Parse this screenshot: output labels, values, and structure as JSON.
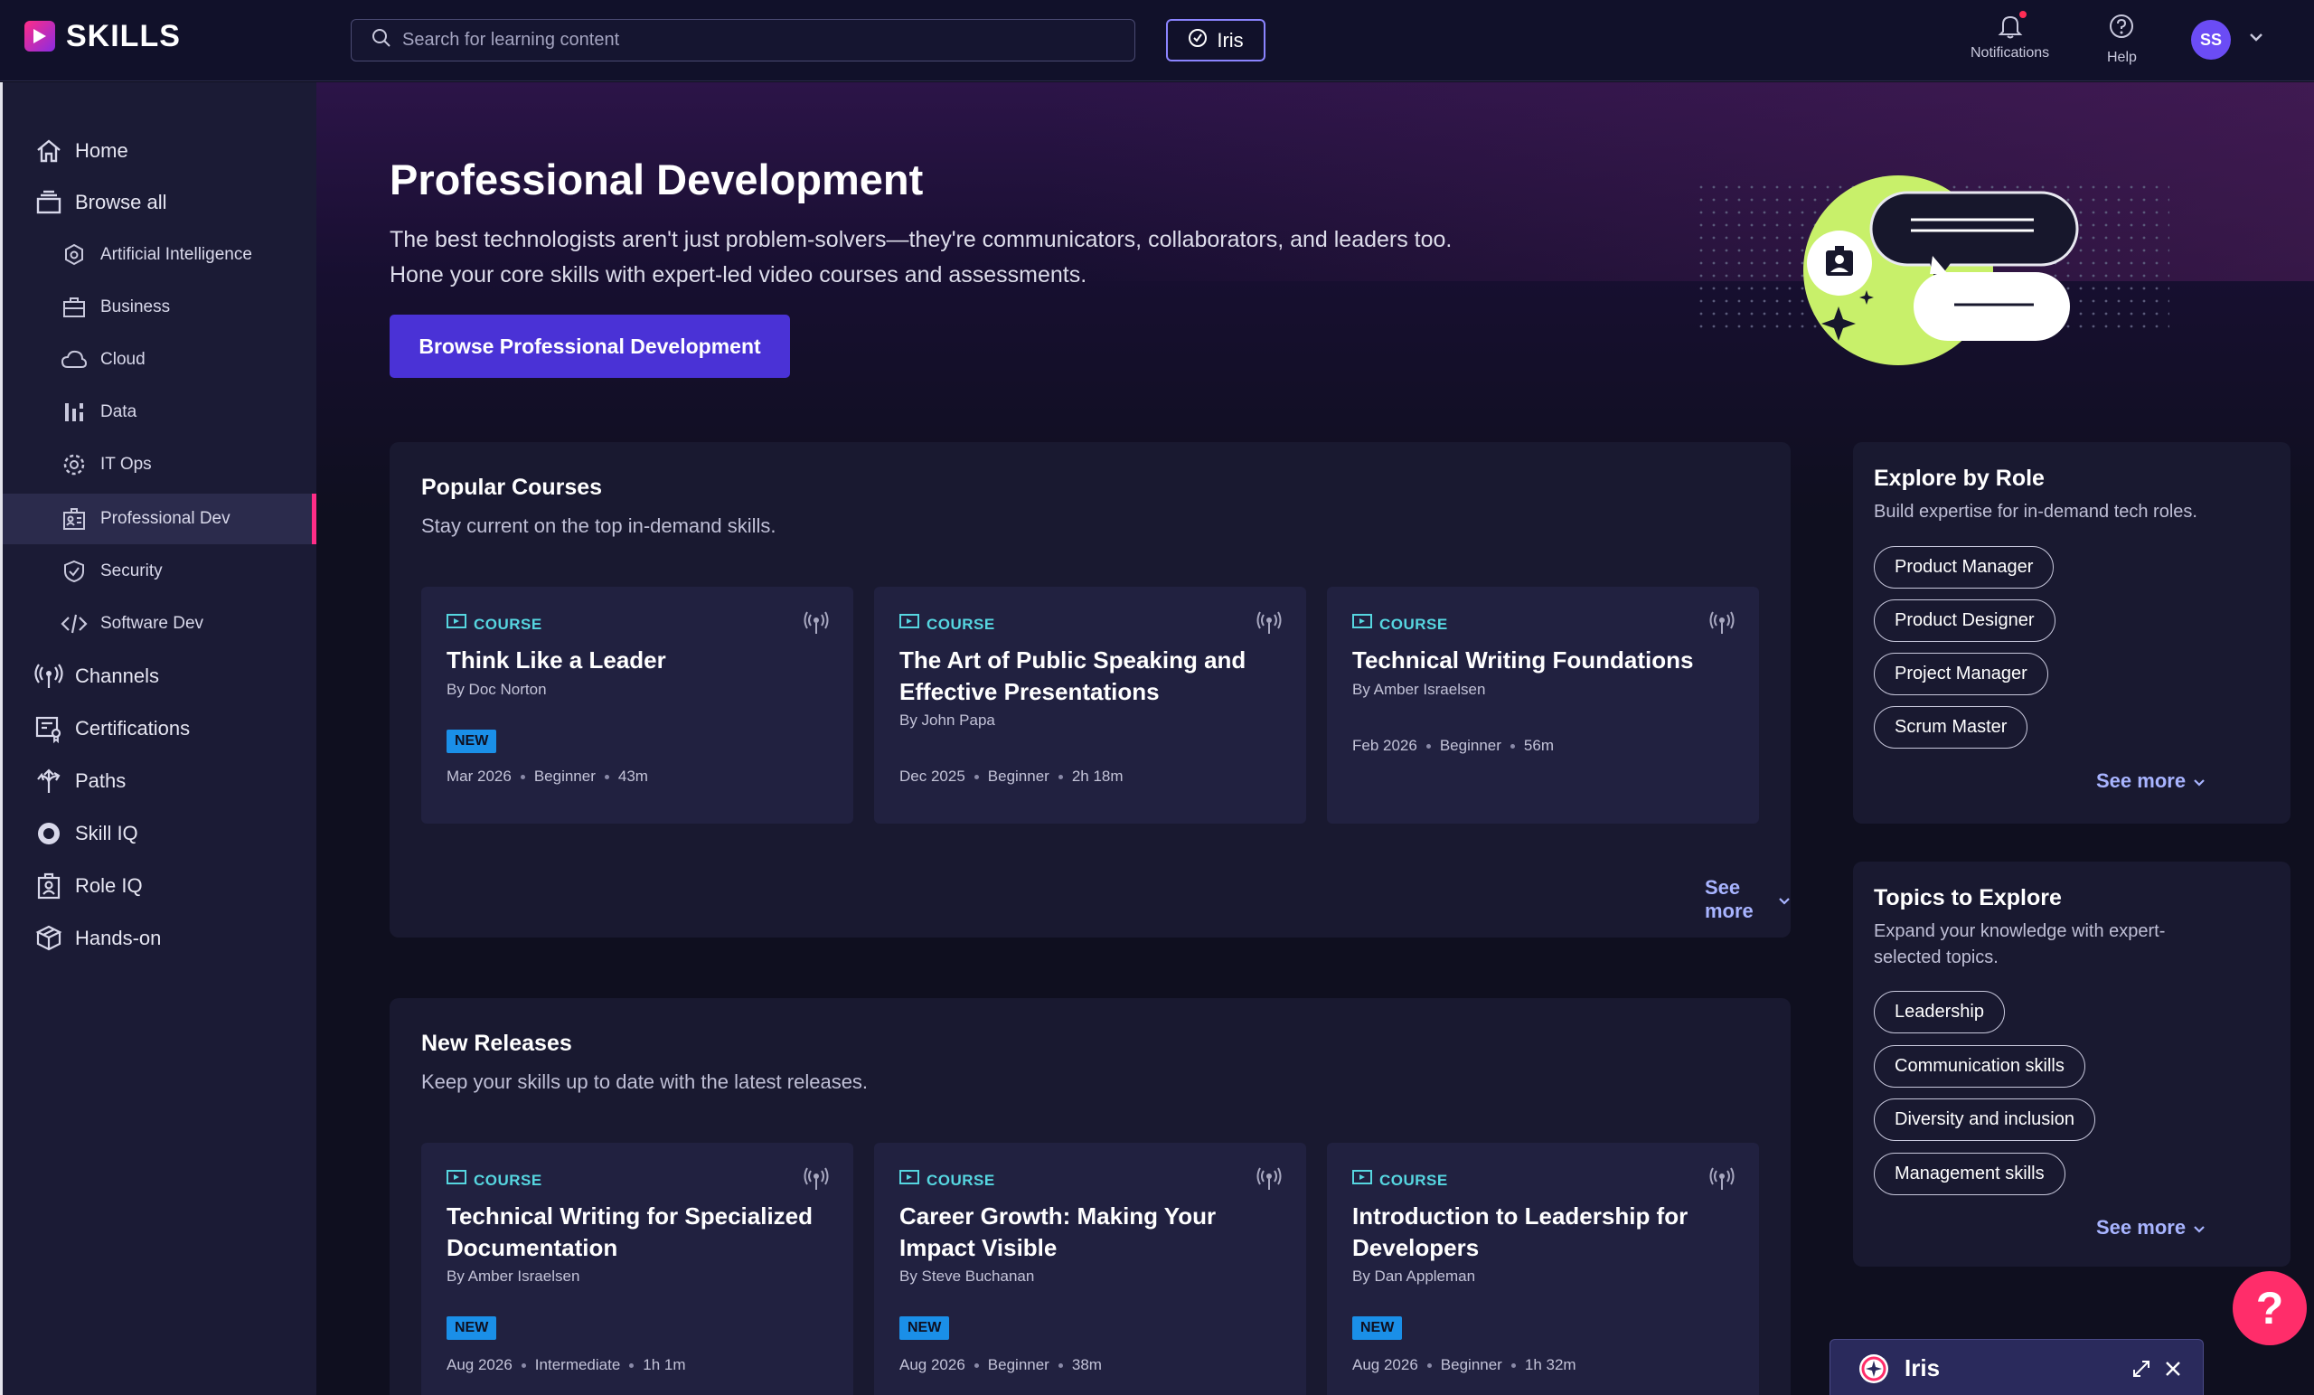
{
  "brand": {
    "name": "SKILLS"
  },
  "topbar": {
    "search_placeholder": "Search for learning content",
    "iris_label": "Iris",
    "notifications_label": "Notifications",
    "help_label": "Help",
    "avatar_initials": "SS"
  },
  "sidebar": {
    "items": [
      {
        "label": "Home",
        "icon": "home-icon"
      },
      {
        "label": "Browse all",
        "icon": "browse-icon"
      },
      {
        "label": "Artificial Intelligence",
        "icon": "ai-icon"
      },
      {
        "label": "Business",
        "icon": "briefcase-icon"
      },
      {
        "label": "Cloud",
        "icon": "cloud-icon"
      },
      {
        "label": "Data",
        "icon": "data-icon"
      },
      {
        "label": "IT Ops",
        "icon": "gear-icon"
      },
      {
        "label": "Professional Dev",
        "icon": "id-card-icon",
        "active": true
      },
      {
        "label": "Security",
        "icon": "shield-icon"
      },
      {
        "label": "Software Dev",
        "icon": "code-icon"
      },
      {
        "label": "Channels",
        "icon": "broadcast-icon"
      },
      {
        "label": "Certifications",
        "icon": "certificate-icon"
      },
      {
        "label": "Paths",
        "icon": "paths-icon"
      },
      {
        "label": "Skill IQ",
        "icon": "skill-iq-icon"
      },
      {
        "label": "Role IQ",
        "icon": "role-iq-icon"
      },
      {
        "label": "Hands-on",
        "icon": "hands-on-icon"
      }
    ]
  },
  "hero": {
    "title": "Professional Development",
    "description": "The best technologists aren't just problem-solvers—they're communicators, collaborators, and leaders too. Hone your core skills with expert-led video courses and assessments.",
    "button_label": "Browse Professional Development"
  },
  "popular": {
    "title": "Popular Courses",
    "subtitle": "Stay current on the top in-demand skills.",
    "see_more": "See more",
    "cards": [
      {
        "tag": "COURSE",
        "title": "Think Like a Leader",
        "author": "By Doc Norton",
        "badge": "NEW",
        "date": "Mar 2026",
        "level": "Beginner",
        "duration": "43m"
      },
      {
        "tag": "COURSE",
        "title": "The Art of Public Speaking and Effective Presentations",
        "author": "By John Papa",
        "date": "Dec 2025",
        "level": "Beginner",
        "duration": "2h 18m"
      },
      {
        "tag": "COURSE",
        "title": "Technical Writing Foundations",
        "author": "By Amber Israelsen",
        "date": "Feb 2026",
        "level": "Beginner",
        "duration": "56m"
      }
    ]
  },
  "new_releases": {
    "title": "New Releases",
    "subtitle": "Keep your skills up to date with the latest releases.",
    "cards": [
      {
        "tag": "COURSE",
        "title": "Technical Writing for Specialized Documentation",
        "author": "By Amber Israelsen",
        "badge": "NEW",
        "date": "Aug 2026",
        "level": "Intermediate",
        "duration": "1h 1m"
      },
      {
        "tag": "COURSE",
        "title": "Career Growth: Making Your Impact Visible",
        "author": "By Steve Buchanan",
        "badge": "NEW",
        "date": "Aug 2026",
        "level": "Beginner",
        "duration": "38m"
      },
      {
        "tag": "COURSE",
        "title": "Introduction to Leadership for Developers",
        "author": "By Dan Appleman",
        "badge": "NEW",
        "date": "Aug 2026",
        "level": "Beginner",
        "duration": "1h 32m"
      }
    ]
  },
  "roles": {
    "title": "Explore by Role",
    "subtitle": "Build expertise for in-demand tech roles.",
    "chips": [
      "Product Manager",
      "Product Designer",
      "Project Manager",
      "Scrum Master"
    ],
    "see_more": "See more"
  },
  "topics": {
    "title": "Topics to Explore",
    "subtitle_line1": "Expand your knowledge with expert-",
    "subtitle_line2": "selected topics.",
    "chips": [
      "Leadership",
      "Communication skills",
      "Diversity and inclusion",
      "Management skills"
    ],
    "see_more": "See more"
  },
  "help_fab": {
    "label": "?"
  },
  "iris_dock": {
    "label": "Iris"
  },
  "colors": {
    "accent": "#4a32d6",
    "brand_pink": "#ff2d87",
    "tag_cyan": "#56d6e0",
    "badge_blue": "#1a8fe8",
    "lime": "#c8f06a"
  }
}
